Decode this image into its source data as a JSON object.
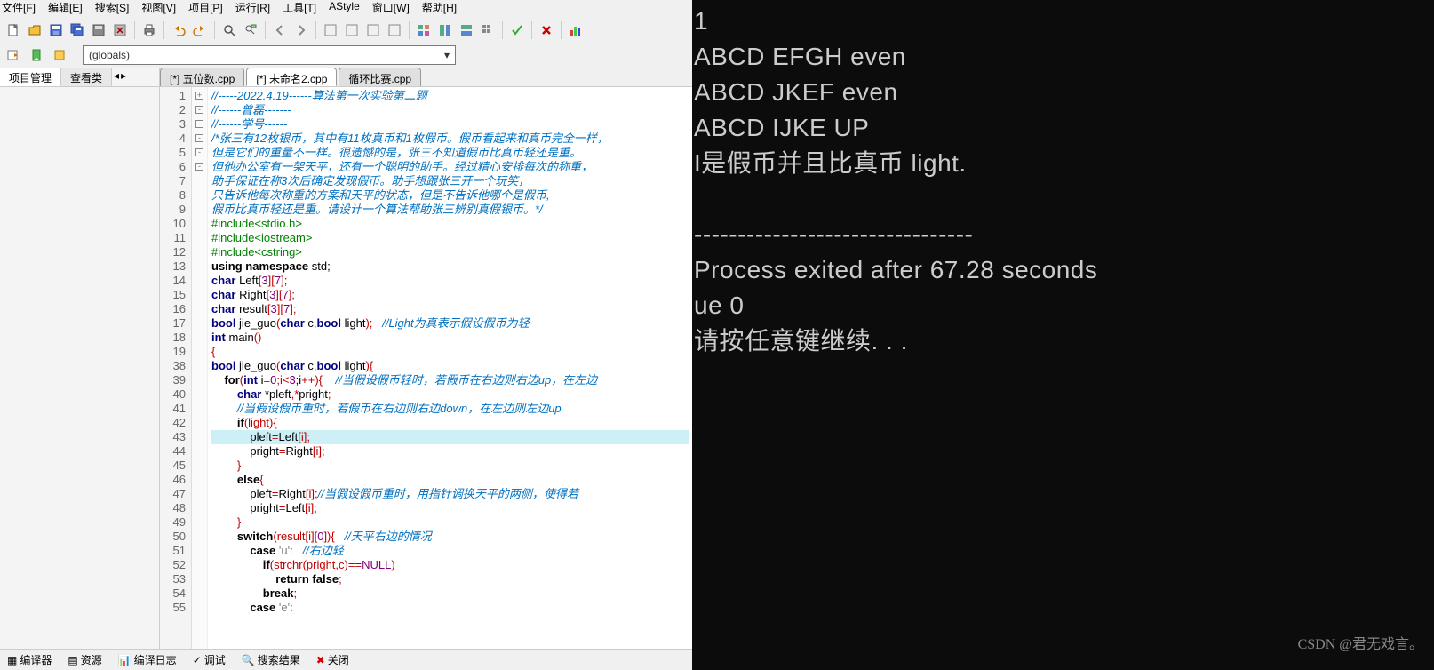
{
  "menu": [
    "文件[F]",
    "编辑[E]",
    "搜索[S]",
    "视图[V]",
    "项目[P]",
    "运行[R]",
    "工具[T]",
    "AStyle",
    "窗口[W]",
    "帮助[H]"
  ],
  "combo": "(globals)",
  "side_tabs": {
    "a": "项目管理",
    "b": "查看类"
  },
  "editor_tabs": [
    {
      "label": "[*] 五位数.cpp",
      "active": false
    },
    {
      "label": "[*] 未命名2.cpp",
      "active": true
    },
    {
      "label": "循环比赛.cpp",
      "active": false
    }
  ],
  "lines": [
    {
      "n": "1",
      "t": "//-----2022.4.19------算法第一次实验第二题",
      "c": "cm"
    },
    {
      "n": "2",
      "t": "//------曾磊-------",
      "c": "cm"
    },
    {
      "n": "3",
      "t": "//------学号------",
      "c": "cm"
    },
    {
      "n": "4",
      "t": "/*张三有12枚银币，其中有11枚真币和1枚假币。假币看起来和真币完全一样，",
      "c": "cm"
    },
    {
      "n": "5",
      "t": "但是它们的重量不一样。很遗憾的是，张三不知道假币比真币轻还是重。",
      "c": "cm"
    },
    {
      "n": "6",
      "t": "但他办公室有一架天平，还有一个聪明的助手。经过精心安排每次的称重，",
      "c": "cm"
    },
    {
      "n": "7",
      "t": "助手保证在称3次后确定发现假币。助手想跟张三开一个玩笑，",
      "c": "cm"
    },
    {
      "n": "8",
      "t": "只告诉他每次称重的方案和天平的状态，但是不告诉他哪个是假币,",
      "c": "cm"
    },
    {
      "n": "9",
      "t": "假币比真币轻还是重。请设计一个算法帮助张三辨别真假银币。*/",
      "c": "cm"
    },
    {
      "n": "10",
      "t": "#include<stdio.h>",
      "c": "pp"
    },
    {
      "n": "11",
      "t": "#include<iostream>",
      "c": "pp"
    },
    {
      "n": "12",
      "t": "#include<cstring>",
      "c": "pp"
    },
    {
      "n": "13",
      "h": [
        {
          "t": "using namespace ",
          "c": "kw"
        },
        {
          "t": "std",
          "c": ""
        },
        {
          "t": ";",
          "c": ""
        }
      ]
    },
    {
      "n": "14",
      "h": [
        {
          "t": "char ",
          "c": "ty"
        },
        {
          "t": "Left",
          "c": ""
        },
        {
          "t": "[",
          "c": "op"
        },
        {
          "t": "3",
          "c": "nm"
        },
        {
          "t": "][",
          "c": "op"
        },
        {
          "t": "7",
          "c": "nm"
        },
        {
          "t": "];",
          "c": "op"
        }
      ]
    },
    {
      "n": "15",
      "h": [
        {
          "t": "char ",
          "c": "ty"
        },
        {
          "t": "Right",
          "c": ""
        },
        {
          "t": "[",
          "c": "op"
        },
        {
          "t": "3",
          "c": "nm"
        },
        {
          "t": "][",
          "c": "op"
        },
        {
          "t": "7",
          "c": "nm"
        },
        {
          "t": "];",
          "c": "op"
        }
      ]
    },
    {
      "n": "16",
      "h": [
        {
          "t": "char ",
          "c": "ty"
        },
        {
          "t": "result",
          "c": ""
        },
        {
          "t": "[",
          "c": "op"
        },
        {
          "t": "3",
          "c": "nm"
        },
        {
          "t": "][",
          "c": "op"
        },
        {
          "t": "7",
          "c": "nm"
        },
        {
          "t": "];",
          "c": "op"
        }
      ]
    },
    {
      "n": "17",
      "h": [
        {
          "t": "bool ",
          "c": "ty"
        },
        {
          "t": "jie_guo",
          "c": ""
        },
        {
          "t": "(",
          "c": "op"
        },
        {
          "t": "char ",
          "c": "ty"
        },
        {
          "t": "c",
          "c": ""
        },
        {
          "t": ",",
          "c": "op"
        },
        {
          "t": "bool ",
          "c": "ty"
        },
        {
          "t": "light",
          "c": ""
        },
        {
          "t": ");   ",
          "c": "op"
        },
        {
          "t": "//Light为真表示假设假币为轻",
          "c": "cm"
        }
      ]
    },
    {
      "n": "18",
      "h": [
        {
          "t": "int ",
          "c": "ty"
        },
        {
          "t": "main",
          "c": ""
        },
        {
          "t": "()",
          "c": "op"
        }
      ]
    },
    {
      "n": "19",
      "h": [
        {
          "t": "{",
          "c": "op"
        }
      ],
      "fold": "+"
    },
    {
      "n": "38",
      "h": [
        {
          "t": "bool ",
          "c": "ty"
        },
        {
          "t": "jie_guo",
          "c": ""
        },
        {
          "t": "(",
          "c": "op"
        },
        {
          "t": "char ",
          "c": "ty"
        },
        {
          "t": "c",
          "c": ""
        },
        {
          "t": ",",
          "c": "op"
        },
        {
          "t": "bool ",
          "c": "ty"
        },
        {
          "t": "light",
          "c": ""
        },
        {
          "t": "){",
          "c": "op"
        }
      ],
      "fold": "-"
    },
    {
      "n": "39",
      "h": [
        {
          "t": "    for",
          "c": "kw"
        },
        {
          "t": "(",
          "c": "op"
        },
        {
          "t": "int ",
          "c": "ty"
        },
        {
          "t": "i",
          "c": ""
        },
        {
          "t": "=",
          "c": "op"
        },
        {
          "t": "0",
          "c": "nm"
        },
        {
          "t": ";i<",
          "c": "op"
        },
        {
          "t": "3",
          "c": "nm"
        },
        {
          "t": ";i",
          "c": ""
        },
        {
          "t": "++){    ",
          "c": "op"
        },
        {
          "t": "//当假设假币轻时，若假币在右边则右边up，在左边",
          "c": "cm"
        }
      ],
      "fold": "-"
    },
    {
      "n": "40",
      "h": [
        {
          "t": "        char ",
          "c": "ty"
        },
        {
          "t": "*pleft",
          "c": ""
        },
        {
          "t": ",*",
          "c": "op"
        },
        {
          "t": "pright",
          "c": ""
        },
        {
          "t": ";",
          "c": "op"
        }
      ]
    },
    {
      "n": "41",
      "t": "        //当假设假币重时，若假币在右边则右边down，在左边则左边up",
      "c": "cm"
    },
    {
      "n": "42",
      "h": [
        {
          "t": "        if",
          "c": "kw"
        },
        {
          "t": "(light){",
          "c": "op"
        }
      ],
      "fold": "-"
    },
    {
      "n": "43",
      "h": [
        {
          "t": "            pleft",
          "c": ""
        },
        {
          "t": "=",
          "c": "op"
        },
        {
          "t": "Left",
          "c": ""
        },
        {
          "t": "[i];",
          "c": "op"
        }
      ],
      "hl": true
    },
    {
      "n": "44",
      "h": [
        {
          "t": "            pright",
          "c": ""
        },
        {
          "t": "=",
          "c": "op"
        },
        {
          "t": "Right",
          "c": ""
        },
        {
          "t": "[i];",
          "c": "op"
        }
      ]
    },
    {
      "n": "45",
      "h": [
        {
          "t": "        }",
          "c": "op"
        }
      ]
    },
    {
      "n": "46",
      "h": [
        {
          "t": "        else",
          "c": "kw"
        },
        {
          "t": "{",
          "c": "op"
        }
      ],
      "fold": "-"
    },
    {
      "n": "47",
      "h": [
        {
          "t": "            pleft",
          "c": ""
        },
        {
          "t": "=",
          "c": "op"
        },
        {
          "t": "Right",
          "c": ""
        },
        {
          "t": "[i];",
          "c": "op"
        },
        {
          "t": "//当假设假币重时，用指针调换天平的两侧，使得若",
          "c": "cm"
        }
      ]
    },
    {
      "n": "48",
      "h": [
        {
          "t": "            pright",
          "c": ""
        },
        {
          "t": "=",
          "c": "op"
        },
        {
          "t": "Left",
          "c": ""
        },
        {
          "t": "[i];",
          "c": "op"
        }
      ]
    },
    {
      "n": "49",
      "h": [
        {
          "t": "        }",
          "c": "op"
        }
      ]
    },
    {
      "n": "50",
      "h": [
        {
          "t": "        switch",
          "c": "kw"
        },
        {
          "t": "(result[i][",
          "c": "op"
        },
        {
          "t": "0",
          "c": "nm"
        },
        {
          "t": "]){   ",
          "c": "op"
        },
        {
          "t": "//天平右边的情况",
          "c": "cm"
        }
      ],
      "fold": "-"
    },
    {
      "n": "51",
      "h": [
        {
          "t": "            case ",
          "c": "kw"
        },
        {
          "t": "'u'",
          "c": "st"
        },
        {
          "t": ":   ",
          "c": "op"
        },
        {
          "t": "//右边轻",
          "c": "cm"
        }
      ]
    },
    {
      "n": "52",
      "h": [
        {
          "t": "                if",
          "c": "kw"
        },
        {
          "t": "(strchr(pright",
          "c": "op"
        },
        {
          "t": ",c)",
          "c": "op"
        },
        {
          "t": "==",
          "c": "op"
        },
        {
          "t": "NULL",
          "c": "nm"
        },
        {
          "t": ")",
          "c": "op"
        }
      ]
    },
    {
      "n": "53",
      "h": [
        {
          "t": "                    return ",
          "c": "kw"
        },
        {
          "t": "false",
          "c": "kw"
        },
        {
          "t": ";",
          "c": "op"
        }
      ]
    },
    {
      "n": "54",
      "h": [
        {
          "t": "                break",
          "c": "kw"
        },
        {
          "t": ";",
          "c": "op"
        }
      ]
    },
    {
      "n": "55",
      "h": [
        {
          "t": "            case ",
          "c": "kw"
        },
        {
          "t": "'e'",
          "c": "st"
        },
        {
          "t": ":",
          "c": "op"
        }
      ]
    }
  ],
  "bottom_tabs": [
    "编译器",
    "资源",
    "编译日志",
    "调试",
    "搜索结果",
    "关闭"
  ],
  "terminal": "1\nABCD EFGH even\nABCD JKEF even\nABCD IJKE UP\nI是假币并且比真币 light.\n\n--------------------------------\nProcess exited after 67.28 seconds\nue 0\n请按任意键继续. . .",
  "watermark": "CSDN @君无戏言。"
}
